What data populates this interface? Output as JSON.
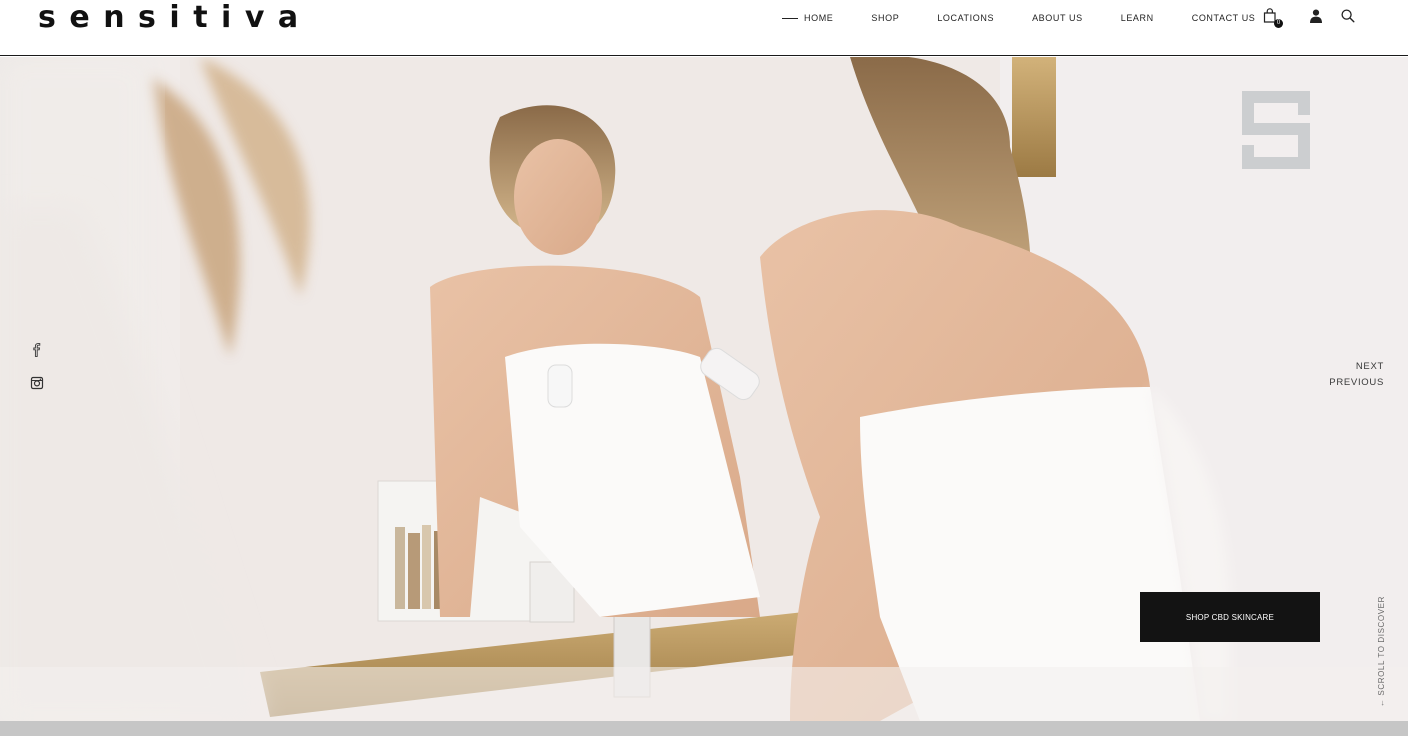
{
  "brand": {
    "logo_text": "sensitiva"
  },
  "nav": {
    "items": [
      {
        "label": "HOME",
        "active": true
      },
      {
        "label": "SHOP"
      },
      {
        "label": "LOCATIONS"
      },
      {
        "label": "ABOUT US"
      },
      {
        "label": "LEARN"
      },
      {
        "label": "CONTACT US"
      }
    ]
  },
  "header_icons": {
    "cart": {
      "icon": "shopping-bag-icon",
      "count": "0"
    },
    "account": {
      "icon": "user-icon"
    },
    "search": {
      "icon": "search-icon"
    }
  },
  "social": [
    {
      "icon": "facebook-icon"
    },
    {
      "icon": "instagram-icon"
    }
  ],
  "slider": {
    "next_label": "NEXT",
    "previous_label": "PREVIOUS",
    "cta_label": "SHOP CBD SKINCARE",
    "scroll_label": "← SCROLL TO DISCOVER"
  },
  "colors": {
    "text": "#111111",
    "cta_background": "#131313",
    "cta_text": "#ffffff",
    "hero_tone": "#ece6e2",
    "bottom_bar": "#c6c6c6"
  }
}
